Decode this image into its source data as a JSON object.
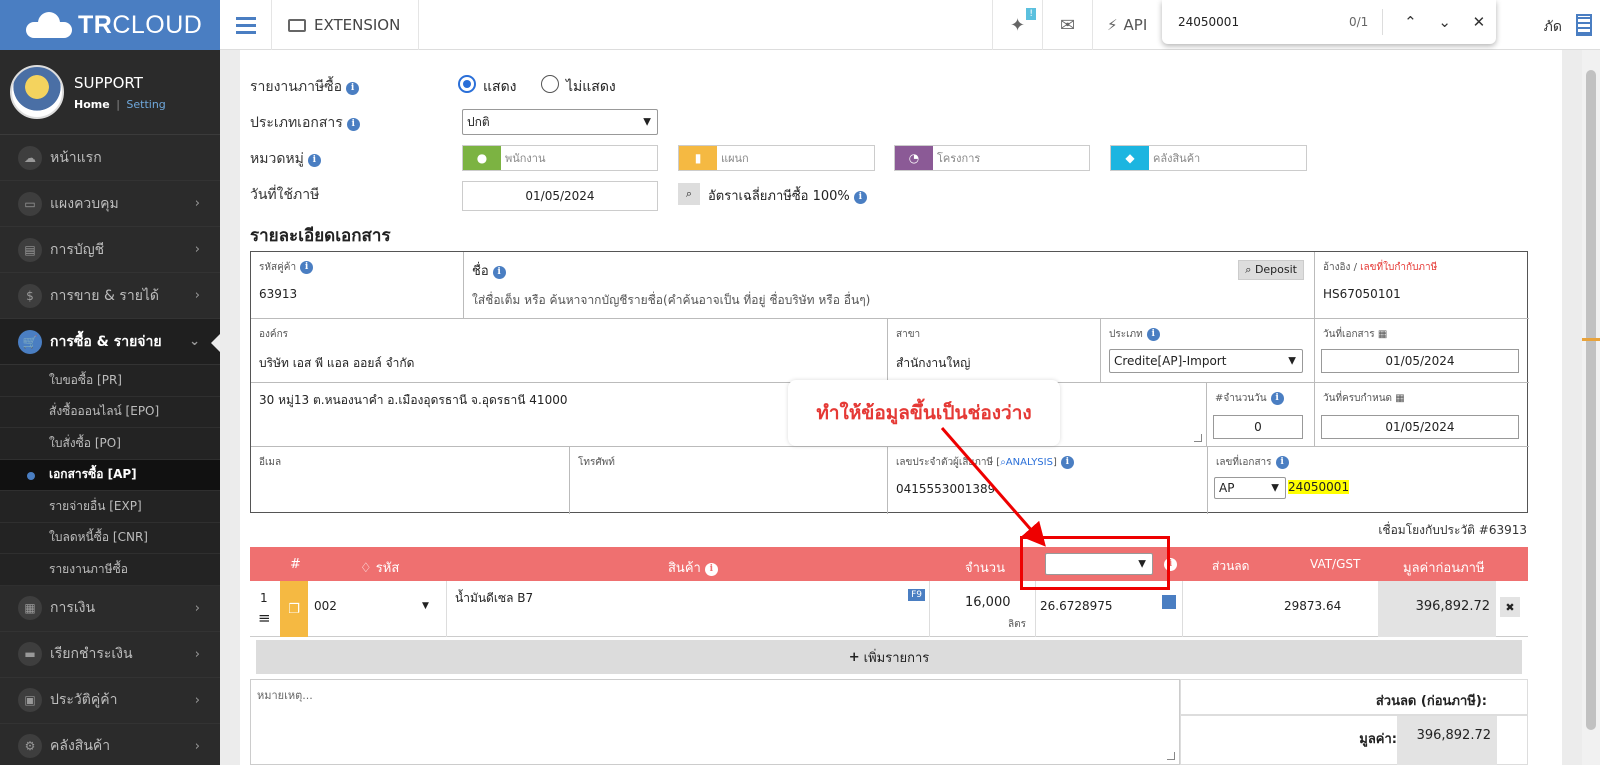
{
  "brand": {
    "name_bold": "TR",
    "name_rest": "CLOUD"
  },
  "user": {
    "name": "SUPPORT",
    "home": "Home",
    "separator": "|",
    "setting": "Setting"
  },
  "sidebar": {
    "items": [
      {
        "label": "หน้าแรก",
        "icon": "cloud-icon",
        "glyph": "☁"
      },
      {
        "label": "แผงควบคุม",
        "icon": "monitor-icon",
        "glyph": "▭"
      },
      {
        "label": "การบัญชี",
        "icon": "book-icon",
        "glyph": "▤"
      },
      {
        "label": "การขาย & รายได้",
        "icon": "dollar-icon",
        "glyph": "$"
      },
      {
        "label": "การซื้อ & รายจ่าย",
        "icon": "cart-icon",
        "glyph": "🛒"
      }
    ],
    "sub_items": [
      "ใบขอซื้อ [PR]",
      "สั่งซื้อออนไลน์ [EPO]",
      "ใบสั่งซื้อ [PO]",
      "เอกสารซื้อ [AP]",
      "รายจ่ายอื่น [EXP]",
      "ใบลดหนี้ซื้อ [CNR]",
      "รายงานภาษีซื้อ"
    ],
    "items_after": [
      {
        "label": "การเงิน",
        "icon": "calendar-icon",
        "glyph": "▦"
      },
      {
        "label": "เรียกชำระเงิน",
        "icon": "bill-icon",
        "glyph": "▬"
      },
      {
        "label": "ประวัติคู่ค้า",
        "icon": "contact-icon",
        "glyph": "▣"
      },
      {
        "label": "คลังสินค้า",
        "icon": "warehouse-icon",
        "glyph": "⚙"
      }
    ]
  },
  "topbar": {
    "extension": "EXTENSION",
    "badge": "!",
    "api": "API",
    "company_tail": "ภัด"
  },
  "findbar": {
    "query": "24050001",
    "count": "0/1",
    "up": "⌃",
    "down": "⌄",
    "close": "✕"
  },
  "form": {
    "tax_report_label": "รายงานภาษีซื้อ",
    "show": "แสดง",
    "hide": "ไม่แสดง",
    "doc_type_label": "ประเภทเอกสาร",
    "doc_type_value": "ปกติ",
    "category_label": "หมวดหมู่",
    "employee_ph": "พนักงาน",
    "department_ph": "แผนก",
    "project_ph": "โครงการ",
    "warehouse_ph": "คลังสินค้า",
    "tax_date_label": "วันที่ใช้ภาษี",
    "tax_date": "01/05/2024",
    "avg_tax_rate": "อัตราเฉลี่ยภาษีซื้อ 100%"
  },
  "doc": {
    "title": "รายละเอียดเอกสาร",
    "supplier_code_label": "รหัสคู่ค้า",
    "supplier_code": "63913",
    "name_label": "ชื่อ",
    "name_hint": "ใส่ชื่อเต็ม หรือ ค้นหาจากบัญชีรายชื่อ(คำค้นอาจเป็น ที่อยู่ ชื่อบริษัท หรือ อื่นๆ)",
    "deposit": "Deposit",
    "ref_label": "อ้างอิง /",
    "ref_label_red": "เลขที่ใบกำกับภาษี",
    "ref_value": "HS67050101",
    "org_label": "องค์กร",
    "org_value": "บริษัท เอส พี แอล ออยล์ จำกัด",
    "branch_label": "สาขา",
    "branch_value": "สำนักงานใหญ่",
    "type_label": "ประเภท",
    "type_value": "Credite[AP]-Import",
    "doc_date_label": "วันที่เอกสาร",
    "doc_date": "01/05/2024",
    "address": "30 หมู่13 ต.หนองนาคำ อ.เมืองอุดรธานี จ.อุดรธานี 41000",
    "days_label": "#จำนวนวัน",
    "days_value": "0",
    "due_date_label": "วันที่ครบกำหนด",
    "due_date": "01/05/2024",
    "email_label": "อีเมล",
    "phone_label": "โทรศัพท์",
    "taxid_label": "เลขประจำตัวผู้เสียภาษี [",
    "analysis": "ANALYSIS",
    "taxid_close": "]",
    "taxid_value": "0415553001389",
    "docno_label": "เลขที่เอกสาร",
    "docno_prefix": "AP",
    "docno_value": "24050001",
    "history": "เชื่อมโยงกับประวัติ #63913"
  },
  "table": {
    "headers": {
      "no": "#",
      "code": "รหัส",
      "product": "สินค้า",
      "qty": "จำนวน",
      "discount": "ส่วนลด",
      "vat": "VAT/GST",
      "pretax": "มูลค่าก่อนภาษี"
    },
    "rows": [
      {
        "no": "1",
        "code": "002",
        "product": "น้ำมันดีเซล B7",
        "f9": "F9",
        "qty": "16,000",
        "unit": "ลิตร",
        "price": "26.6728975",
        "vat": "29873.64",
        "pretax": "396,892.72",
        "delete": "✖"
      }
    ],
    "add_row": "เพิ่มรายการ"
  },
  "footer": {
    "notes_ph": "หมายเหตุ...",
    "discount_pretax": "ส่วนลด (ก่อนภาษี):",
    "amount_label": "มูลค่า:",
    "amount_value": "396,892.72"
  },
  "annotation": {
    "text": "ทำให้ข้อมูลขึ้นเป็นช่องว่าง",
    "color": "#e53935"
  },
  "colors": {
    "brand": "#4a7ec2",
    "table_header": "#ef7070",
    "highlight": "#ffff00"
  }
}
